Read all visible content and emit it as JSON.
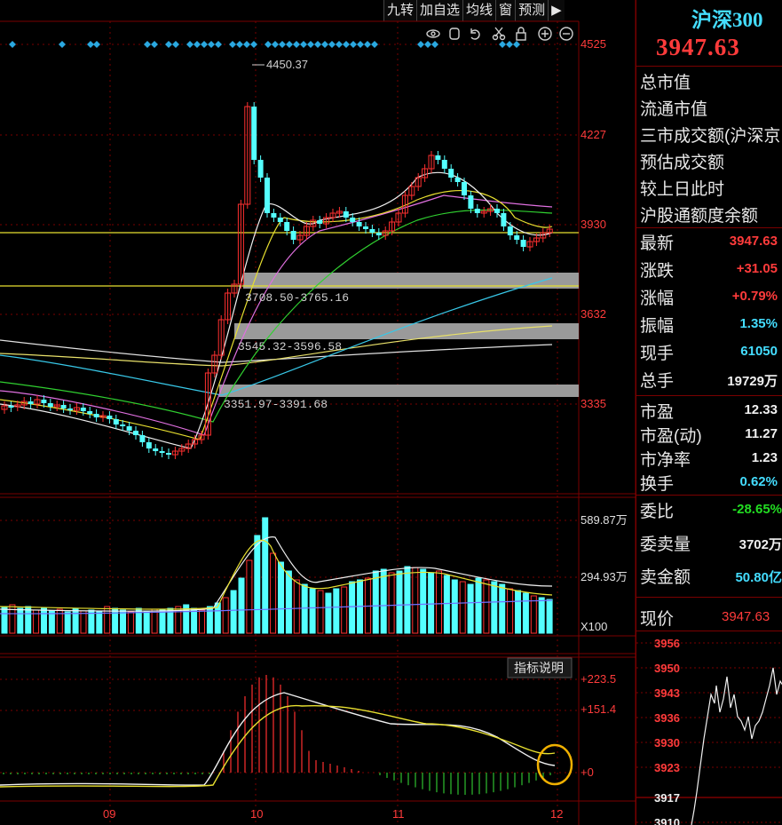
{
  "toolbar": {
    "items": [
      "九转",
      "加自选",
      "均线",
      "窗",
      "预测",
      "▶"
    ]
  },
  "chart": {
    "price_axis": [
      "4525",
      "4227",
      "3930",
      "3632",
      "3335"
    ],
    "high_label": "4450.37",
    "zones": [
      "3708.50-3765.16",
      "3545.32-3596.58",
      "3351.97-3391.68"
    ],
    "volume_axis": [
      "589.87万",
      "294.93万"
    ],
    "volume_unit": "X100",
    "macd_axis": [
      "+223.5",
      "+151.4",
      "+0"
    ],
    "indicator_button": "指标说明",
    "month_labels": [
      "09",
      "10",
      "11",
      "12"
    ],
    "colors": {
      "up": "#ff3030",
      "down": "#54ffff",
      "grid": "#7a0000",
      "yellow": "#e8e030",
      "gray": "#9a9a9a"
    }
  },
  "panel": {
    "index_name": "沪深300",
    "price": "3947.63",
    "rows_top": [
      "总市值",
      "流通市值",
      "三市成交额(沪深京",
      "预估成交额",
      "较上日此时",
      "沪股通额度余额"
    ],
    "quotes": [
      {
        "label": "最新",
        "value": "3947.63",
        "color": "red"
      },
      {
        "label": "涨跌",
        "value": "+31.05",
        "color": "red"
      },
      {
        "label": "涨幅",
        "value": "+0.79%",
        "color": "red"
      },
      {
        "label": "振幅",
        "value": "1.35%",
        "color": "cyan"
      },
      {
        "label": "现手",
        "value": "61050",
        "color": "cyan"
      },
      {
        "label": "总手",
        "value": "19729万",
        "color": "white"
      }
    ],
    "ratios": [
      {
        "label": "市盈",
        "value": "12.33",
        "color": "white"
      },
      {
        "label": "市盈(动)",
        "value": "11.27",
        "color": "white"
      },
      {
        "label": "市净率",
        "value": "1.23",
        "color": "white"
      },
      {
        "label": "换手",
        "value": "0.62%",
        "color": "cyan"
      }
    ],
    "orders": [
      {
        "label": "委比",
        "value": "-28.65%",
        "color": "green"
      },
      {
        "label": "委卖量",
        "value": "3702万",
        "color": "white"
      },
      {
        "label": "卖金额",
        "value": "50.80亿",
        "color": "cyan"
      }
    ],
    "now_label": "现价",
    "now_value": "3947.63",
    "mini_axis": [
      "3956",
      "3950",
      "3943",
      "3936",
      "3930",
      "3923",
      "3917",
      "3910"
    ]
  }
}
